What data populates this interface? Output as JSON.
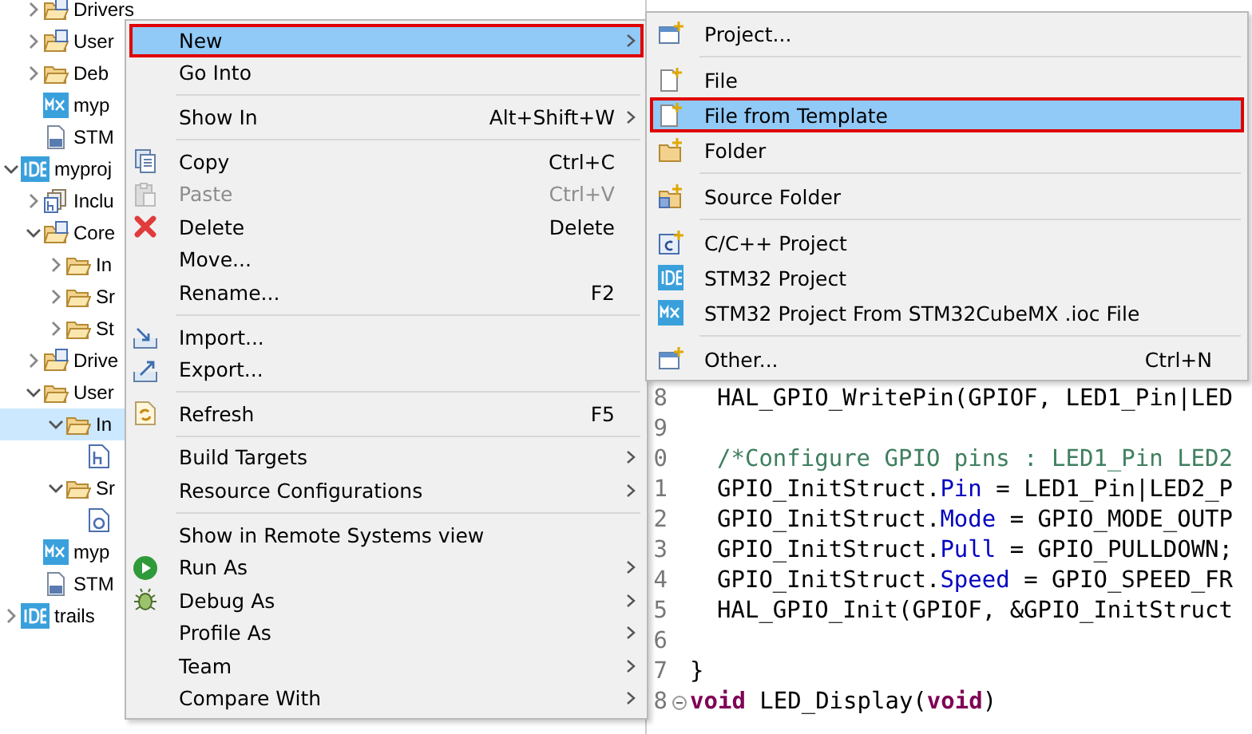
{
  "tree": {
    "continued": [
      {
        "label": "Drivers",
        "kind": "source-folder",
        "expanded": false,
        "selected": false
      },
      {
        "label": "User",
        "kind": "source-folder",
        "expanded": false,
        "selected": false
      },
      {
        "label": "Deb",
        "kind": "folder",
        "expanded": false,
        "selected": false
      },
      {
        "label": "myp",
        "kind": "mx",
        "selected": false
      },
      {
        "label": "STM",
        "kind": "linker",
        "selected": false
      }
    ],
    "items": [
      {
        "label": "myproj",
        "kind": "ide",
        "expanded": true,
        "selected": false,
        "children": [
          {
            "label": "Inclu",
            "kind": "includes",
            "expanded": false,
            "selected": false
          },
          {
            "label": "Core",
            "kind": "source-folder",
            "expanded": true,
            "selected": false,
            "children": [
              {
                "label": "In",
                "kind": "folder",
                "expanded": false,
                "selected": false
              },
              {
                "label": "Sr",
                "kind": "folder",
                "expanded": false,
                "selected": false
              },
              {
                "label": "St",
                "kind": "folder",
                "expanded": false,
                "selected": false
              }
            ]
          },
          {
            "label": "Drive",
            "kind": "source-folder",
            "expanded": false,
            "selected": false
          },
          {
            "label": "User",
            "kind": "folder",
            "expanded": true,
            "selected": false,
            "children": [
              {
                "label": "In",
                "kind": "folder",
                "expanded": true,
                "selected": true,
                "children": [
                  {
                    "kind": "header",
                    "selected": false
                  }
                ]
              },
              {
                "label": "Sr",
                "kind": "folder",
                "expanded": true,
                "selected": false,
                "children": [
                  {
                    "kind": "source",
                    "selected": false
                  }
                ]
              }
            ]
          },
          {
            "label": "myp",
            "kind": "mx",
            "selected": false
          },
          {
            "label": "STM",
            "kind": "linker",
            "selected": false
          }
        ]
      },
      {
        "label": "trails",
        "kind": "ide",
        "expanded": false,
        "selected": false
      }
    ]
  },
  "editor": {
    "lines": [
      {
        "number": "8",
        "indented": true,
        "parts": [
          {
            "kind": "plain",
            "text": "HAL_GPIO_WritePin(GPIOF, LED1_Pin|LED"
          }
        ]
      },
      {
        "number": "9"
      },
      {
        "number": "0",
        "indented": true,
        "parts": [
          {
            "kind": "comment",
            "text": "/*Configure GPIO pins : LED1_Pin LED2"
          }
        ]
      },
      {
        "number": "1",
        "indented": true,
        "parts": [
          {
            "kind": "plain",
            "text": "GPIO_InitStruct."
          },
          {
            "kind": "field",
            "text": "Pin"
          },
          {
            "kind": "plain",
            "text": " = LED1_Pin|LED2_P"
          }
        ]
      },
      {
        "number": "2",
        "indented": true,
        "parts": [
          {
            "kind": "plain",
            "text": "GPIO_InitStruct."
          },
          {
            "kind": "field",
            "text": "Mode"
          },
          {
            "kind": "plain",
            "text": " = GPIO_MODE_OUTP"
          }
        ]
      },
      {
        "number": "3",
        "indented": true,
        "parts": [
          {
            "kind": "plain",
            "text": "GPIO_InitStruct."
          },
          {
            "kind": "field",
            "text": "Pull"
          },
          {
            "kind": "plain",
            "text": " = GPIO_PULLDOWN;"
          }
        ]
      },
      {
        "number": "4",
        "indented": true,
        "parts": [
          {
            "kind": "plain",
            "text": "GPIO_InitStruct."
          },
          {
            "kind": "field",
            "text": "Speed"
          },
          {
            "kind": "plain",
            "text": " = GPIO_SPEED_FR"
          }
        ]
      },
      {
        "number": "5",
        "indented": true,
        "parts": [
          {
            "kind": "plain",
            "text": "HAL_GPIO_Init(GPIOF, &GPIO_InitStruct"
          }
        ]
      },
      {
        "number": "6"
      },
      {
        "number": "7",
        "indented": false,
        "parts": [
          {
            "kind": "plain",
            "text": "}"
          }
        ]
      },
      {
        "number": "8",
        "indented": false,
        "foldable": true,
        "parts": [
          {
            "kind": "keyword",
            "text": "void"
          },
          {
            "kind": "plain",
            "text": " LED_Display("
          },
          {
            "kind": "keyword",
            "text": "void"
          },
          {
            "kind": "plain",
            "text": ")"
          }
        ]
      }
    ]
  },
  "context_menu": {
    "items": [
      {
        "kind": "plain",
        "label": "New",
        "submenu": true,
        "disabled": false,
        "selected": true,
        "outlined": true
      },
      {
        "kind": "plain",
        "label": "Go Into",
        "submenu": false,
        "disabled": false,
        "selected": false,
        "outlined": false
      },
      {
        "kind": "separator"
      },
      {
        "kind": "plain",
        "label": "Show In",
        "shortcut": "Alt+Shift+W",
        "submenu": true,
        "disabled": false,
        "selected": false,
        "outlined": false
      },
      {
        "kind": "separator"
      },
      {
        "kind": "copy",
        "label": "Copy",
        "shortcut": "Ctrl+C",
        "submenu": false,
        "disabled": false,
        "selected": false,
        "outlined": false
      },
      {
        "kind": "paste",
        "label": "Paste",
        "shortcut": "Ctrl+V",
        "submenu": false,
        "disabled": true,
        "selected": false,
        "outlined": false
      },
      {
        "kind": "delete",
        "label": "Delete",
        "shortcut": "Delete",
        "submenu": false,
        "disabled": false,
        "selected": false,
        "outlined": false
      },
      {
        "kind": "plain",
        "label": "Move...",
        "submenu": false,
        "disabled": false,
        "selected": false,
        "outlined": false
      },
      {
        "kind": "plain",
        "label": "Rename...",
        "shortcut": "F2",
        "submenu": false,
        "disabled": false,
        "selected": false,
        "outlined": false
      },
      {
        "kind": "separator"
      },
      {
        "kind": "import",
        "label": "Import...",
        "submenu": false,
        "disabled": false,
        "selected": false,
        "outlined": false
      },
      {
        "kind": "export",
        "label": "Export...",
        "submenu": false,
        "disabled": false,
        "selected": false,
        "outlined": false
      },
      {
        "kind": "separator"
      },
      {
        "kind": "refresh",
        "label": "Refresh",
        "shortcut": "F5",
        "submenu": false,
        "disabled": false,
        "selected": false,
        "outlined": false
      },
      {
        "kind": "separator"
      },
      {
        "kind": "plain",
        "label": "Build Targets",
        "submenu": true,
        "disabled": false,
        "selected": false,
        "outlined": false
      },
      {
        "kind": "plain",
        "label": "Resource Configurations",
        "submenu": true,
        "disabled": false,
        "selected": false,
        "outlined": false
      },
      {
        "kind": "separator"
      },
      {
        "kind": "plain",
        "label": "Show in Remote Systems view",
        "submenu": false,
        "disabled": false,
        "selected": false,
        "outlined": false
      },
      {
        "kind": "run",
        "label": "Run As",
        "submenu": true,
        "disabled": false,
        "selected": false,
        "outlined": false
      },
      {
        "kind": "debug",
        "label": "Debug As",
        "submenu": true,
        "disabled": false,
        "selected": false,
        "outlined": false
      },
      {
        "kind": "plain",
        "label": "Profile As",
        "submenu": true,
        "disabled": false,
        "selected": false,
        "outlined": false
      },
      {
        "kind": "plain",
        "label": "Team",
        "submenu": true,
        "disabled": false,
        "selected": false,
        "outlined": false
      },
      {
        "kind": "plain",
        "label": "Compare With",
        "submenu": true,
        "disabled": false,
        "selected": false,
        "outlined": false
      }
    ]
  },
  "new_submenu": {
    "items": [
      {
        "kind": "project",
        "label": "Project...",
        "selected": false,
        "outlined": false
      },
      {
        "kind": "separator"
      },
      {
        "kind": "file",
        "label": "File",
        "selected": false,
        "outlined": false
      },
      {
        "kind": "file",
        "label": "File from Template",
        "selected": true,
        "outlined": true
      },
      {
        "kind": "folder",
        "label": "Folder",
        "selected": false,
        "outlined": false
      },
      {
        "kind": "separator"
      },
      {
        "kind": "source-folder",
        "label": "Source Folder",
        "selected": false,
        "outlined": false
      },
      {
        "kind": "separator"
      },
      {
        "kind": "c-project",
        "label": "C/C++ Project",
        "selected": false,
        "outlined": false
      },
      {
        "kind": "ide",
        "label": "STM32 Project",
        "selected": false,
        "outlined": false
      },
      {
        "kind": "mx",
        "label": "STM32 Project From STM32CubeMX .ioc File",
        "selected": false,
        "outlined": false
      },
      {
        "kind": "separator"
      },
      {
        "kind": "project",
        "label": "Other...",
        "shortcut": "Ctrl+N",
        "selected": false,
        "outlined": false
      }
    ]
  }
}
